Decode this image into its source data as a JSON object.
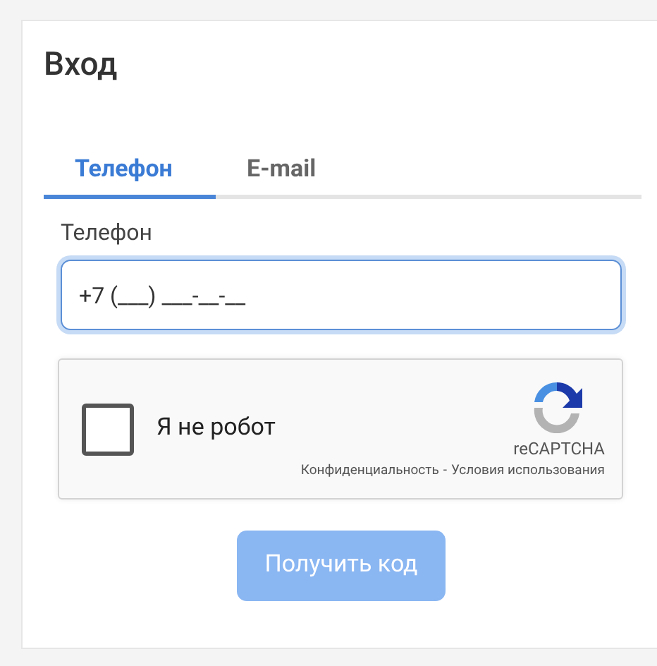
{
  "title": "Вход",
  "tabs": [
    {
      "label": "Телефон",
      "selected": true
    },
    {
      "label": "E-mail",
      "selected": false
    }
  ],
  "phone_field": {
    "label": "Телефон",
    "value": "+7 (___) ___-__-__",
    "focused": true
  },
  "captcha": {
    "label": "Я не робот",
    "checked": false,
    "brand": "reCAPTCHA",
    "links": [
      "Конфиденциальность",
      "Условия использования"
    ],
    "separator": "-"
  },
  "submit_button": {
    "label": "Получить код",
    "disabled": true
  }
}
